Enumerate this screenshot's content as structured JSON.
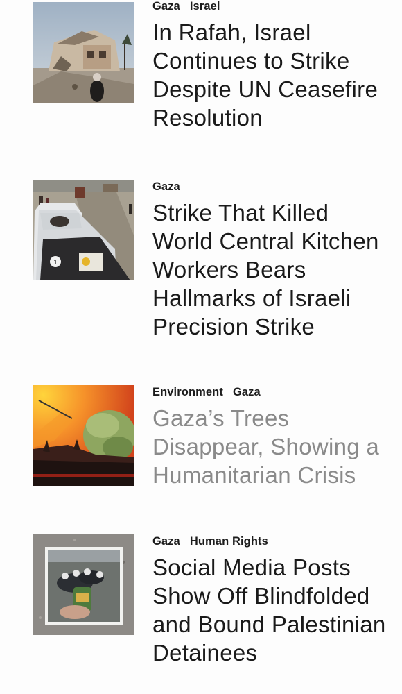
{
  "articles": [
    {
      "tags": [
        "Gaza",
        "Israel"
      ],
      "headline": "In Rafah, Israel Continues to Strike Despite UN Ceasefire Resolution",
      "visited": false,
      "image": "destroyed-building-photo"
    },
    {
      "tags": [
        "Gaza"
      ],
      "headline": "Strike That Killed World Central Kitchen Workers Bears Hallmarks of Israeli Precision Strike",
      "visited": false,
      "image": "damaged-car-photo"
    },
    {
      "tags": [
        "Environment",
        "Gaza"
      ],
      "headline": "Gaza’s Trees Disappear, Showing a Humanitarian Crisis",
      "visited": true,
      "image": "trees-illustration"
    },
    {
      "tags": [
        "Gaza",
        "Human Rights"
      ],
      "headline": "Social Media Posts Show Off Blindfolded and Bound Palestinian Detainees",
      "visited": false,
      "image": "detainees-phone-photo"
    }
  ],
  "colors": {
    "headline": "#1a1a1a",
    "headline_visited": "#8a8a8a",
    "tag": "#1c1c1c",
    "background": "#fdfdfd"
  }
}
